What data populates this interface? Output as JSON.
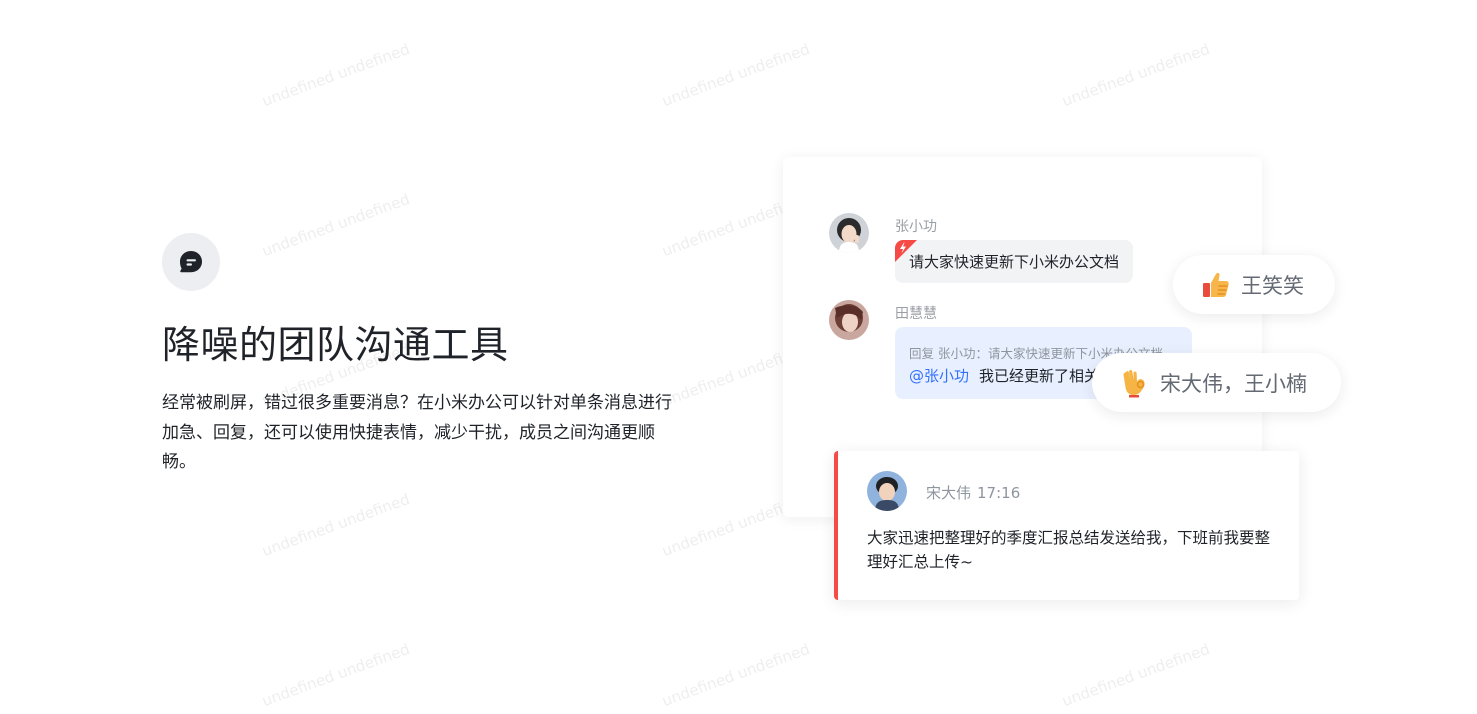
{
  "watermark": {
    "text": "undefined undefined"
  },
  "feature": {
    "icon": "chat-bubble-icon",
    "title": "降噪的团队沟通工具",
    "description": "经常被刷屏，错过很多重要消息？在小米办公可以针对单条消息进行加急、回复，还可以使用快捷表情，减少干扰，成员之间沟通更顺畅。"
  },
  "chat": {
    "messages": [
      {
        "sender": "张小功",
        "avatar": "avatar-zhang-xiaogong",
        "text": "请大家快速更新下小米办公文档",
        "urgent": true
      },
      {
        "sender": "田慧慧",
        "avatar": "avatar-tian-huihui",
        "reply_quote": "回复 张小功：请大家快速更新下小米办公文档",
        "mention": "@张小功",
        "text": "我已经更新了相关文档"
      }
    ]
  },
  "reactions": [
    {
      "icon": "thumbs-up-icon",
      "users": "王笑笑"
    },
    {
      "icon": "ok-hand-icon",
      "users": "宋大伟，王小楠"
    }
  ],
  "pinned_message": {
    "sender": "宋大伟",
    "time": "17:16",
    "avatar": "avatar-song-dawei",
    "text": "大家迅速把整理好的季度汇报总结发送给我，下班前我要整理好汇总上传~"
  },
  "colors": {
    "accent_red": "#f54a45",
    "accent_blue": "#3370ff",
    "bubble_blue": "#e8f0ff",
    "bubble_gray": "#f2f3f5"
  }
}
